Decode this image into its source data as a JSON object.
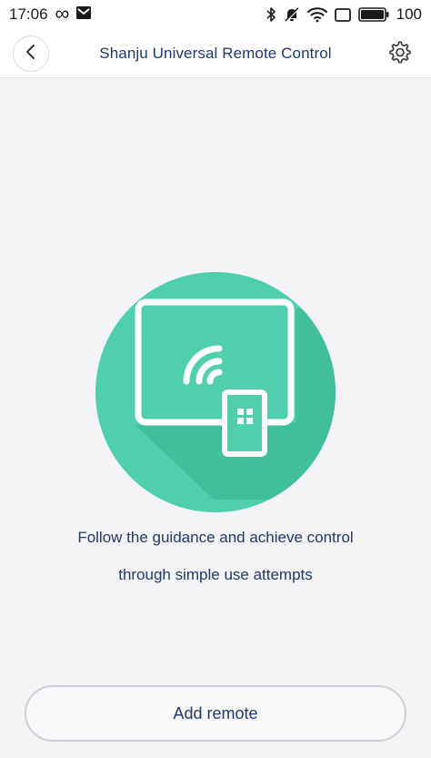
{
  "status_bar": {
    "time": "17:06",
    "infinity_glyph": "∞",
    "battery_level": "100",
    "icons": [
      "infinity-icon",
      "mail-icon",
      "bluetooth-icon",
      "mute-icon",
      "wifi-icon",
      "screen-icon",
      "battery-icon"
    ]
  },
  "header": {
    "title": "Shanju Universal Remote Control",
    "back_icon": "chevron-left-icon",
    "settings_icon": "gear-icon"
  },
  "main": {
    "illustration_icon": "tv-remote-icon",
    "description_line1": "Follow the guidance and achieve control",
    "description_line2": "through simple use attempts",
    "add_button_label": "Add remote"
  },
  "colors": {
    "accent_green": "#4fcfac",
    "text_navy": "#1f3a6b",
    "background": "#f4f4f6"
  }
}
